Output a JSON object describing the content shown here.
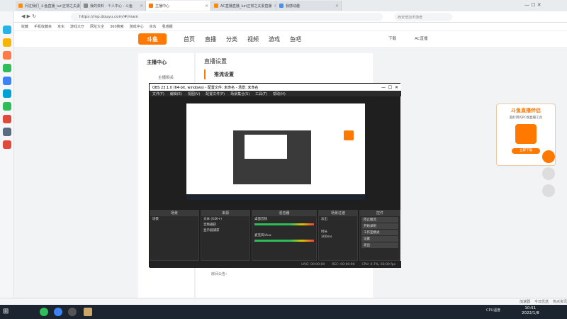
{
  "browser": {
    "tabs": [
      {
        "label": "问过我们_斗鱼直播_iuri正常之夫妻",
        "color": "#ff8c00"
      },
      {
        "label": "我的资料 - 个人中心 - 斗鱼",
        "color": "#888888"
      },
      {
        "label": "主播中心",
        "color": "#ff7800"
      },
      {
        "label": "AC直播直播_iuri正常之夫妻直播",
        "color": "#ff8c00"
      },
      {
        "label": "我感动趣",
        "color": "#4a90e2"
      }
    ],
    "url": "https://mp.douyu.com/#/main",
    "search_placeholder": "西安增加市场增",
    "bookmarks": [
      "收藏",
      "手机收藏夹",
      "京东",
      "游戏大厅",
      "网址大全",
      "360搜索",
      "游戏中心",
      "京东",
      "我感趣"
    ]
  },
  "douyu": {
    "logo": "斗鱼",
    "nav": [
      "首页",
      "直播",
      "分类",
      "视频",
      "游戏",
      "鱼吧"
    ],
    "right_nav": [
      "下载",
      "AC直播"
    ],
    "left_title": "主播中心",
    "left_item": "主播相关",
    "main_title": "直播设置",
    "main_subtitle": "推流设置",
    "bottom_label": "房间公告："
  },
  "obs": {
    "title": "OBS 23.1.0 (64-bit, windows) - 配置文件: 未命名 - 场景: 未命名",
    "menu": [
      "文件(F)",
      "编辑(E)",
      "视图(V)",
      "配置文件(P)",
      "场景集合(S)",
      "工具(T)",
      "帮助(H)"
    ],
    "docks": {
      "scenes": {
        "title": "场景",
        "items": [
          "场景"
        ]
      },
      "sources": {
        "title": "来源",
        "items": [
          "文本 (GDI+)",
          "音频捕获",
          "显示器捕获"
        ]
      },
      "mixer": {
        "title": "混音器",
        "items": [
          "桌面音频",
          "麦克风/Aux"
        ]
      },
      "transitions": {
        "title": "场景过渡",
        "items": [
          "淡出",
          "时长",
          "300ms"
        ]
      },
      "controls": {
        "title": "控件",
        "buttons": [
          "停止推流",
          "开始录制",
          "工作室模式",
          "设置",
          "退出"
        ]
      }
    },
    "status": [
      "LIVE: 00:00:00",
      "REC: 00:00:00",
      "CPU: 0.7%, 60.00 fps"
    ]
  },
  "ad": {
    "title": "斗鱼直播伴侣",
    "subtitle": "超好用的PC端直播工具",
    "button": "立即下载"
  },
  "statusbar": [
    "加速器",
    "今日优选",
    "热点资讯"
  ],
  "taskbar": {
    "time": "10:51",
    "date": "2022/1/8",
    "cpu": "CPU温度"
  }
}
